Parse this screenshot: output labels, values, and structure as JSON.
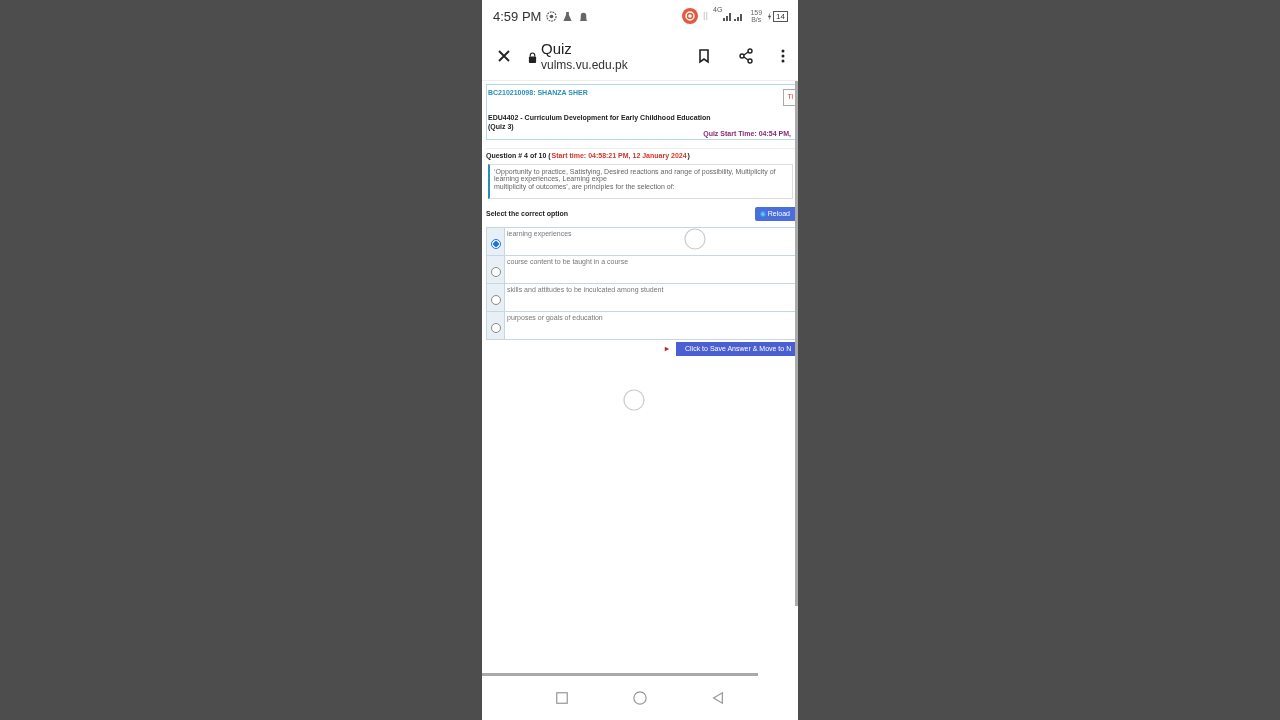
{
  "status_bar": {
    "time": "4:59 PM",
    "network": "4G",
    "speed_value": "159",
    "speed_unit": "B/s",
    "battery": "14"
  },
  "browser": {
    "title": "Quiz",
    "url": "vulms.vu.edu.pk"
  },
  "quiz": {
    "student": "BC210210098: SHANZA SHER",
    "course": "EDU4402 - Curriculum Development for Early Childhood Education",
    "quiz_label": "(Quiz 3)",
    "corner_button": "Ti",
    "quiz_start": "Quiz Start Time: 04:54 PM,",
    "question_label": "Question # 4 of 10 (",
    "question_start": "Start time: 04:58:21 PM, 12 January 2024",
    "question_close": ")",
    "question_lines": [
      "‘Opportunity to practice, Satisfying, Desired reactions and range of possibility, Multiplicity of learning experiences, Learning expe",
      "multiplicity of outcomes’, are principles for the selection of:"
    ],
    "instruction": "Select the correct option",
    "reload_button": "Reload",
    "options": [
      {
        "text": "learning experiences",
        "selected": true
      },
      {
        "text": "course content to be taught in a course",
        "selected": false
      },
      {
        "text": "skills and attitudes to be inculcated among student",
        "selected": false
      },
      {
        "text": "purposes or goals of education",
        "selected": false
      }
    ],
    "save_button": "Click to Save Answer & Move to N"
  }
}
